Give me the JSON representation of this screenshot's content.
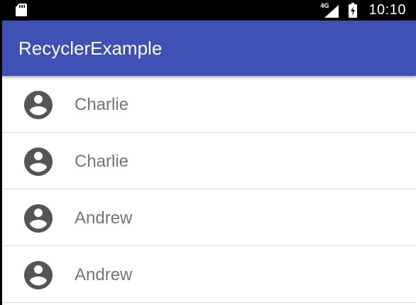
{
  "status_bar": {
    "network_type": "4G",
    "time": "10:10",
    "icons": [
      "sd-card-icon",
      "signal-icon",
      "battery-charging-icon"
    ]
  },
  "app_bar": {
    "title": "RecyclerExample",
    "color": "#3f51b5"
  },
  "list": {
    "items": [
      {
        "name": "Charlie",
        "icon": "account-circle-icon"
      },
      {
        "name": "Charlie",
        "icon": "account-circle-icon"
      },
      {
        "name": "Andrew",
        "icon": "account-circle-icon"
      },
      {
        "name": "Andrew",
        "icon": "account-circle-icon"
      }
    ]
  },
  "colors": {
    "primary": "#3f51b5",
    "text_secondary": "#757575",
    "icon": "#555555",
    "divider": "#d9d9d9"
  }
}
